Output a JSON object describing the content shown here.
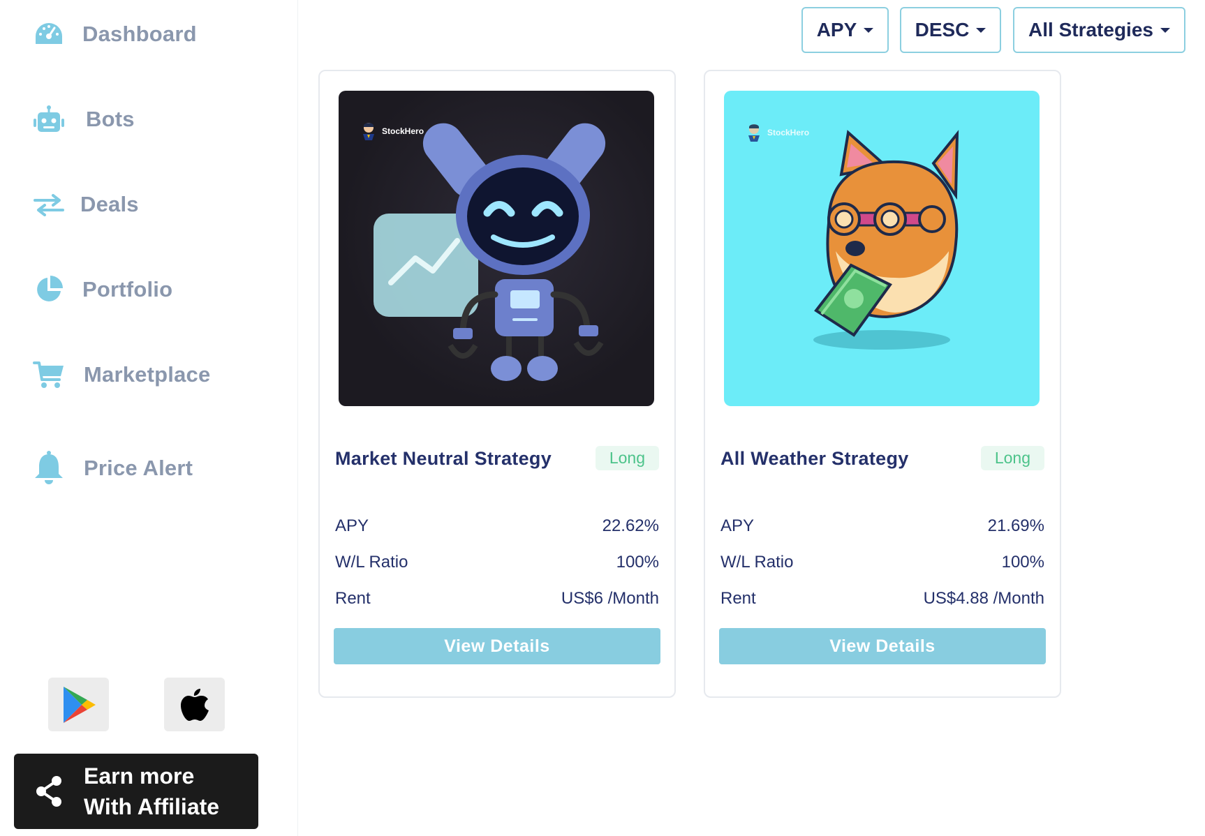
{
  "sidebar": {
    "items": [
      {
        "label": "Dashboard",
        "icon": "speedometer-icon"
      },
      {
        "label": "Bots",
        "icon": "robot-icon"
      },
      {
        "label": "Deals",
        "icon": "swap-arrows-icon"
      },
      {
        "label": "Portfolio",
        "icon": "pie-chart-icon"
      },
      {
        "label": "Marketplace",
        "icon": "cart-icon"
      },
      {
        "label": "Price Alert",
        "icon": "bell-icon"
      }
    ],
    "stores": {
      "google_play": "google-play-icon",
      "apple": "apple-icon"
    },
    "affiliate": {
      "line1": "Earn more",
      "line2": "With Affiliate",
      "icon": "share-icon"
    }
  },
  "filters": {
    "sort_by": "APY",
    "order": "DESC",
    "strategy": "All Strategies"
  },
  "cards": [
    {
      "title": "Market Neutral Strategy",
      "badge": "Long",
      "image_brand": "StockHero",
      "stats": [
        {
          "label": "APY",
          "value": "22.62%"
        },
        {
          "label": "W/L Ratio",
          "value": "100%"
        },
        {
          "label": "Rent",
          "value": "US$6 /Month"
        }
      ],
      "button": "View Details"
    },
    {
      "title": "All Weather Strategy",
      "badge": "Long",
      "image_brand": "StockHero",
      "stats": [
        {
          "label": "APY",
          "value": "21.69%"
        },
        {
          "label": "W/L Ratio",
          "value": "100%"
        },
        {
          "label": "Rent",
          "value": "US$4.88 /Month"
        }
      ],
      "button": "View Details"
    }
  ],
  "colors": {
    "accent": "#88cde0",
    "icon": "#7ecbe3",
    "nav_text": "#8a97ad",
    "title": "#24306a",
    "badge_bg": "#eaf8f1",
    "badge_text": "#4cc38a",
    "card1_bg": "#1e1c24",
    "card2_bg": "#6cecf8"
  }
}
